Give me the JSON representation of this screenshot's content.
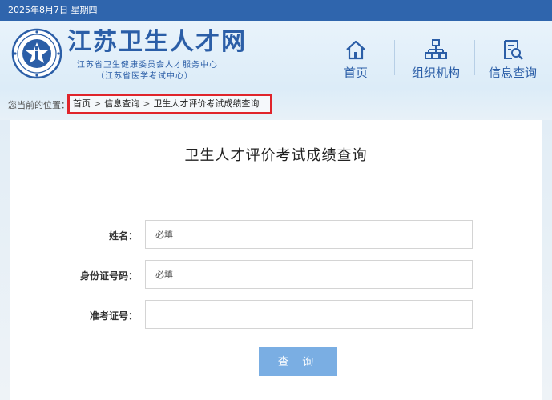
{
  "topbar": {
    "date": "2025年8月7日 星期四"
  },
  "header": {
    "title": "江苏卫生人才网",
    "subtitle1": "江苏省卫生健康委员会人才服务中心",
    "subtitle2": "（江苏省医学考试中心）",
    "nav": [
      {
        "label": "首页",
        "icon": "home-icon"
      },
      {
        "label": "组织机构",
        "icon": "org-chart-icon"
      },
      {
        "label": "信息查询",
        "icon": "search-document-icon"
      }
    ]
  },
  "breadcrumb": {
    "prefix": "您当前的位置：",
    "items": [
      "首页",
      "信息查询",
      "卫生人才评价考试成绩查询"
    ],
    "separator": ">"
  },
  "form": {
    "title": "卫生人才评价考试成绩查询",
    "fields": [
      {
        "label": "姓名：",
        "placeholder": "必填"
      },
      {
        "label": "身份证号码：",
        "placeholder": "必填"
      },
      {
        "label": "准考证号：",
        "placeholder": ""
      }
    ],
    "submit_label": "查 询"
  },
  "colors": {
    "topbar": "#2f65ad",
    "brand": "#2b5ea7",
    "highlight_border": "#e0242b",
    "button": "#7aaee3"
  }
}
